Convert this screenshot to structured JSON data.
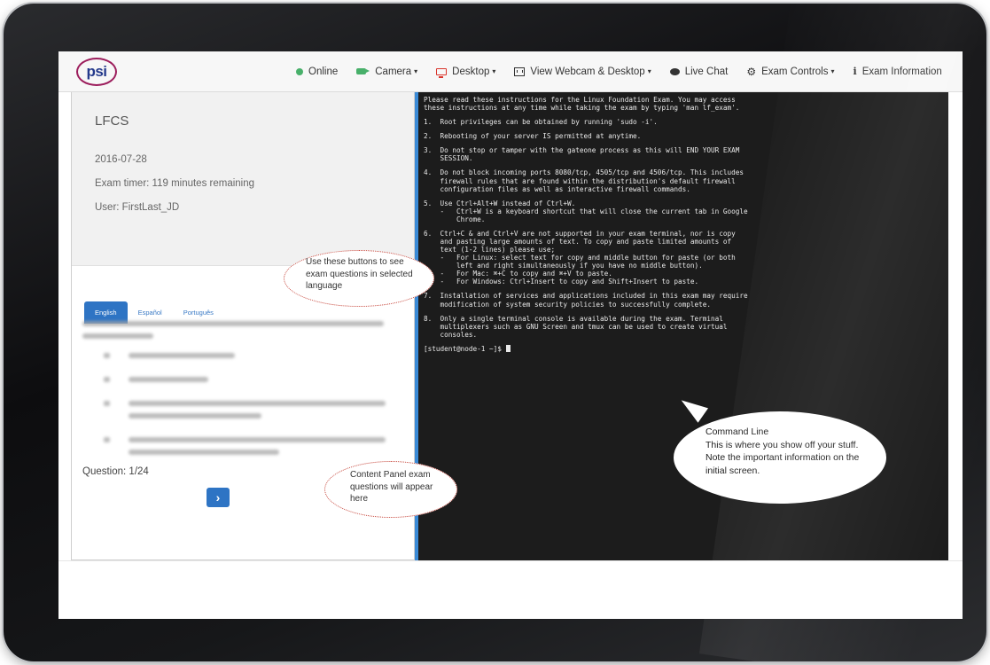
{
  "app": {
    "logo_text": "psi"
  },
  "nav": [
    {
      "label": "Online",
      "icon": "status-dot-icon",
      "caret": ""
    },
    {
      "label": "Camera",
      "icon": "camera-icon",
      "caret": "▾"
    },
    {
      "label": "Desktop",
      "icon": "monitor-icon",
      "caret": "▾"
    },
    {
      "label": "View Webcam & Desktop",
      "icon": "film-icon",
      "caret": "▾"
    },
    {
      "label": "Live Chat",
      "icon": "chat-icon",
      "caret": ""
    },
    {
      "label": "Exam Controls",
      "icon": "gear-icon",
      "caret": "▾"
    },
    {
      "label": "Exam Information",
      "icon": "info-icon",
      "caret": "▾"
    }
  ],
  "exam": {
    "title": "LFCS",
    "date": "2016-07-28",
    "timer": "Exam timer: 119 minutes remaining",
    "user": "User: FirstLast_JD"
  },
  "languages": [
    "English",
    "Español",
    "Português"
  ],
  "question": {
    "label": "Question: 1/24",
    "next_glyph": "›"
  },
  "callouts": {
    "language": "Use these buttons to see exam questions in selected language",
    "content": "Content Panel exam questions will appear here",
    "command_title": "Command Line",
    "command_body": "This is where you show off your stuff.  Note the important information on the initial screen."
  },
  "terminal": {
    "paragraphs": [
      "Please read these instructions for the Linux Foundation Exam. You may access\nthese instructions at any time while taking the exam by typing 'man lf_exam'.",
      "1.  Root privileges can be obtained by running 'sudo -i'.",
      "2.  Rebooting of your server IS permitted at anytime.",
      "3.  Do not stop or tamper with the gateone process as this will END YOUR EXAM\n    SESSION.",
      "4.  Do not block incoming ports 8080/tcp, 4505/tcp and 4506/tcp. This includes\n    firewall rules that are found within the distribution's default firewall\n    configuration files as well as interactive firewall commands.",
      "5.  Use Ctrl+Alt+W instead of Ctrl+W.\n    -   Ctrl+W is a keyboard shortcut that will close the current tab in Google\n        Chrome.",
      "6.  Ctrl+C & and Ctrl+V are not supported in your exam terminal, nor is copy\n    and pasting large amounts of text. To copy and paste limited amounts of\n    text (1-2 lines) please use;\n    -   For Linux: select text for copy and middle button for paste (or both\n        left and right simultaneously if you have no middle button).\n    -   For Mac: ⌘+C to copy and ⌘+V to paste.\n    -   For Windows: Ctrl+Insert to copy and Shift+Insert to paste.",
      "7.  Installation of services and applications included in this exam may require\n    modification of system security policies to successfully complete.",
      "8.  Only a single terminal console is available during the exam. Terminal\n    multiplexers such as GNU Screen and tmux can be used to create virtual\n    consoles."
    ],
    "prompt": "[student@node-1 ~]$ "
  }
}
